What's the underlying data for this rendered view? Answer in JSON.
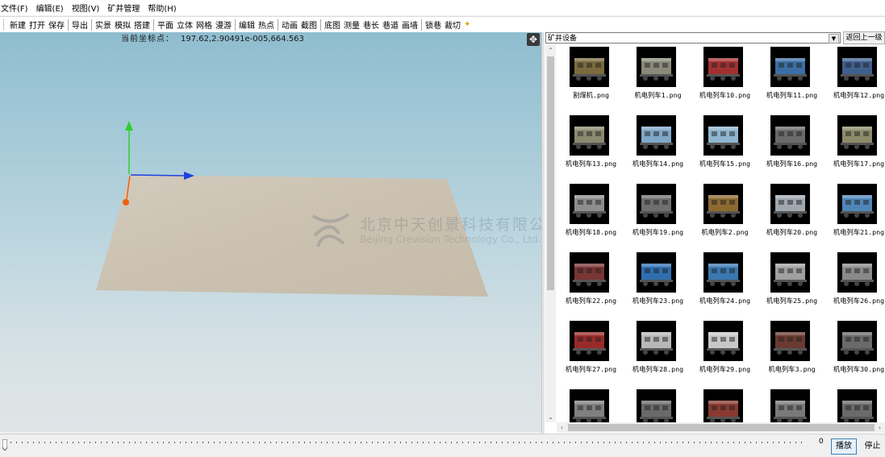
{
  "menu": [
    "文件(F)",
    "编辑(E)",
    "视图(V)",
    "矿井管理",
    "帮助(H)"
  ],
  "toolbar": {
    "groups": [
      [
        "新建",
        "打开",
        "保存"
      ],
      [
        "导出"
      ],
      [
        "实景",
        "模拟",
        "搭建"
      ],
      [
        "平面",
        "立体",
        "网格",
        "漫游"
      ],
      [
        "编辑",
        "热点"
      ],
      [
        "动画",
        "截图"
      ],
      [
        "底图",
        "测量",
        "巷长",
        "巷道",
        "画墙"
      ],
      [
        "锁巷",
        "裁切"
      ]
    ]
  },
  "viewport": {
    "coord_label": "当前坐标点：",
    "coord_value": "197.62,2.90491e-005,664.563",
    "watermark_cn": "北京中天创景科技有限公司",
    "watermark_en": "Beijing Crevision Technology Co., Ltd."
  },
  "browser": {
    "folder": "矿井设备",
    "up_label": "返回上一级",
    "items": [
      "割煤机.png",
      "机电列车1.png",
      "机电列车10.png",
      "机电列车11.png",
      "机电列车12.png",
      "机电列车13.png",
      "机电列车14.png",
      "机电列车15.png",
      "机电列车16.png",
      "机电列车17.png",
      "机电列车18.png",
      "机电列车19.png",
      "机电列车2.png",
      "机电列车20.png",
      "机电列车21.png",
      "机电列车22.png",
      "机电列车23.png",
      "机电列车24.png",
      "机电列车25.png",
      "机电列车26.png",
      "机电列车27.png",
      "机电列车28.png",
      "机电列车29.png",
      "机电列车3.png",
      "机电列车30.png",
      "",
      "",
      "",
      "",
      ""
    ],
    "thumb_colors": [
      "#7a6a3c",
      "#8a8a7a",
      "#a33030",
      "#3b6ea5",
      "#3e5f8c",
      "#8a8a70",
      "#7fa7c8",
      "#8fb5d0",
      "#6a6a6a",
      "#8c8c6a",
      "#8d8d8d",
      "#6f6f6f",
      "#8c6a30",
      "#a0a8b0",
      "#4f86b8",
      "#7a3535",
      "#2f6fb0",
      "#3a78b0",
      "#a0a0a0",
      "#8a8a8a",
      "#9a2a2a",
      "#b8b8b8",
      "#c8c8c8",
      "#6a3a30",
      "#6a6a6a",
      "#808080",
      "#6a6a6a",
      "#8a3a30",
      "#7a7a7a",
      "#6a6a6a"
    ]
  },
  "bottom": {
    "time_value": "0",
    "play_label": "播放",
    "stop_label": "停止"
  }
}
